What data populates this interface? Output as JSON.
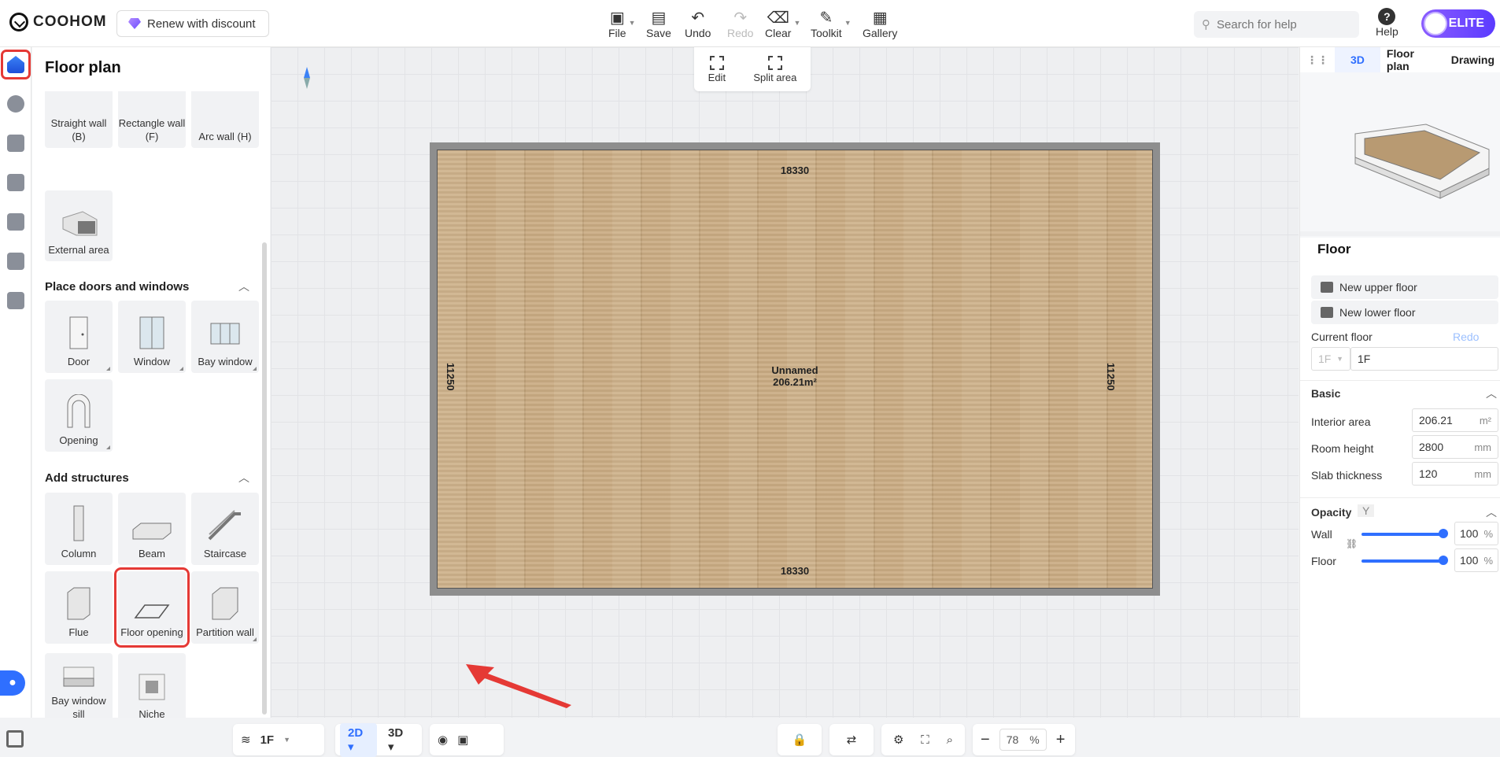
{
  "app": {
    "brand": "COOHOM",
    "renew_label": "Renew with discount"
  },
  "toolbar": {
    "file": "File",
    "save": "Save",
    "undo": "Undo",
    "redo": "Redo",
    "clear": "Clear",
    "toolkit": "Toolkit",
    "gallery": "Gallery"
  },
  "search": {
    "placeholder": "Search for help"
  },
  "help": {
    "label": "Help"
  },
  "badge": {
    "label": "ELITE"
  },
  "left_panel": {
    "title": "Floor plan",
    "walls": [
      {
        "label": "Straight wall (B)"
      },
      {
        "label": "Rectangle wall (F)"
      },
      {
        "label": "Arc wall (H)"
      },
      {
        "label": "External area"
      }
    ],
    "doors_section": "Place doors and windows",
    "doors": [
      {
        "label": "Door"
      },
      {
        "label": "Window"
      },
      {
        "label": "Bay window"
      },
      {
        "label": "Opening"
      }
    ],
    "structures_section": "Add structures",
    "structures": [
      {
        "label": "Column"
      },
      {
        "label": "Beam"
      },
      {
        "label": "Staircase"
      },
      {
        "label": "Flue"
      },
      {
        "label": "Floor opening"
      },
      {
        "label": "Partition wall"
      },
      {
        "label": "Bay window sill"
      },
      {
        "label": "Niche"
      }
    ]
  },
  "canvas": {
    "edit": "Edit",
    "split_area": "Split area",
    "room_name": "Unnamed",
    "room_area": "206.21m²",
    "dim_width": "18330",
    "dim_height": "11250"
  },
  "bottom": {
    "floor": "1F",
    "mode_2d": "2D",
    "mode_3d": "3D",
    "zoom": "78",
    "zoom_unit": "%"
  },
  "right_panel": {
    "tabs": [
      "3D",
      "Floor plan",
      "Drawing"
    ],
    "title": "Floor",
    "new_upper": "New upper floor",
    "new_lower": "New lower floor",
    "current_floor_label": "Current floor",
    "redo": "Redo",
    "floor_select": "1F",
    "floor_name": "1F",
    "basic": "Basic",
    "interior_area_label": "Interior area",
    "interior_area": "206.21",
    "interior_area_unit": "m²",
    "room_height_label": "Room height",
    "room_height": "2800",
    "slab_label": "Slab thickness",
    "slab": "120",
    "mm": "mm",
    "opacity": "Opacity",
    "opacity_key": "Y",
    "wall_label": "Wall",
    "wall_value": "100",
    "floor_label": "Floor",
    "floor_value": "100",
    "pct": "%"
  },
  "colors": {
    "accent": "#2f6fff",
    "highlight": "#e53935",
    "elite": "#6b4cff"
  }
}
